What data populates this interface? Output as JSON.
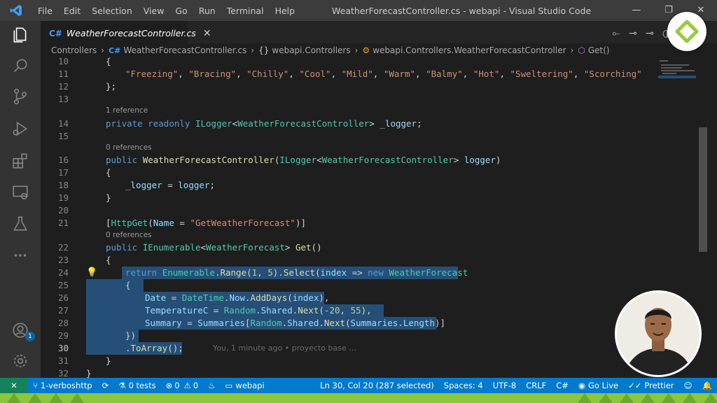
{
  "titlebar": {
    "menu": [
      "File",
      "Edit",
      "Selection",
      "View",
      "Go",
      "Run",
      "Terminal",
      "Help"
    ],
    "title": "WeatherForecastController.cs - webapi - Visual Studio Code"
  },
  "tab": {
    "label": "WeatherForecastController.cs",
    "close": "✕"
  },
  "breadcrumbs": {
    "folder": "Controllers",
    "file": "WeatherForecastController.cs",
    "namespace": "webapi.Controllers",
    "class": "webapi.Controllers.WeatherForecastController",
    "method": "Get()"
  },
  "editor": {
    "lines": [
      {
        "n": "10"
      },
      {
        "n": "11"
      },
      {
        "n": "12"
      },
      {
        "n": "13"
      },
      {
        "n": "14"
      },
      {
        "n": "15"
      },
      {
        "n": "16"
      },
      {
        "n": "17"
      },
      {
        "n": "18"
      },
      {
        "n": "19"
      },
      {
        "n": "20"
      },
      {
        "n": "21"
      },
      {
        "n": "22"
      },
      {
        "n": "23"
      },
      {
        "n": "24"
      },
      {
        "n": "25"
      },
      {
        "n": "26"
      },
      {
        "n": "27"
      },
      {
        "n": "28"
      },
      {
        "n": "29"
      },
      {
        "n": "30"
      },
      {
        "n": "31"
      },
      {
        "n": "32"
      }
    ],
    "lens_1_reference": "1 reference",
    "lens_0_references_a": "0 references",
    "lens_0_references_b": "0 references",
    "blame": "You, 1 minute ago • proyecto base …",
    "summaries": [
      "\"Freezing\"",
      "\"Bracing\"",
      "\"Chilly\"",
      "\"Cool\"",
      "\"Mild\"",
      "\"Warm\"",
      "\"Balmy\"",
      "\"Hot\"",
      "\"Sweltering\"",
      "\"Scorching\""
    ],
    "route_name": "\"GetWeatherForecast\""
  },
  "statusbar": {
    "branch": "1-verboshttp",
    "tests": "0 tests",
    "errors": "0",
    "warnings": "0",
    "project": "webapi",
    "position": "Ln 30, Col 20 (287 selected)",
    "spaces": "Spaces: 4",
    "encoding": "UTF-8",
    "eol": "CRLF",
    "language": "C#",
    "golive": "Go Live",
    "prettier": "Prettier"
  },
  "badges": {
    "accounts": "1"
  }
}
